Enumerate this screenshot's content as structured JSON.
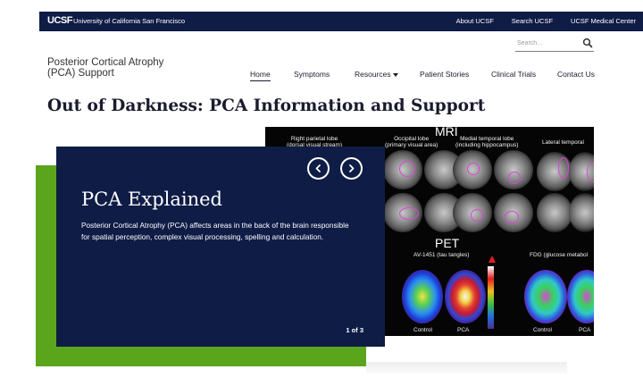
{
  "topbar": {
    "logo": "UCSF",
    "institution": "University of California San Francisco",
    "links": [
      "About UCSF",
      "Search UCSF",
      "UCSF Medical Center"
    ],
    "background": "#0f1c46"
  },
  "search": {
    "placeholder": "Search...",
    "icon": "search-icon"
  },
  "site": {
    "title_line1": "Posterior Cortical Atrophy",
    "title_line2": "(PCA) Support"
  },
  "nav": {
    "items": [
      "Home",
      "Symptoms",
      "Resources",
      "Patient Stories",
      "Clinical Trials",
      "Contact Us"
    ],
    "active": "Home"
  },
  "page": {
    "title": "Out of Darkness: PCA Information and Support"
  },
  "slide": {
    "heading": "PCA Explained",
    "body": "Posterior Cortical Atrophy (PCA) affects areas in the back of the brain responsible for spatial perception, complex visual processing, spelling and calculation.",
    "counter": "1 of 3",
    "prev_icon": "chevron-left-icon",
    "next_icon": "chevron-right-icon"
  },
  "image": {
    "mri_heading": "MRI",
    "pet_heading": "PET",
    "label_parietal_1": "Right parietal lobe",
    "label_parietal_2": "(dorsal visual stream)",
    "label_occipital_1": "Occipital lobe",
    "label_occipital_2": "(primary visual area)",
    "label_temporal_1": "Medial temporal lobe",
    "label_temporal_2": "(including hippocampus)",
    "label_lateral": "Lateral temporal",
    "label_av": "AV-1451 (tau tangles)",
    "label_fdg": "FDG (glucose metabol",
    "label_control_1": "Control",
    "label_pca_1": "PCA",
    "label_control_2": "Control",
    "label_pca_2": "PCA"
  },
  "colors": {
    "accent_green": "#5aa51c",
    "navy": "#0f1c46"
  }
}
